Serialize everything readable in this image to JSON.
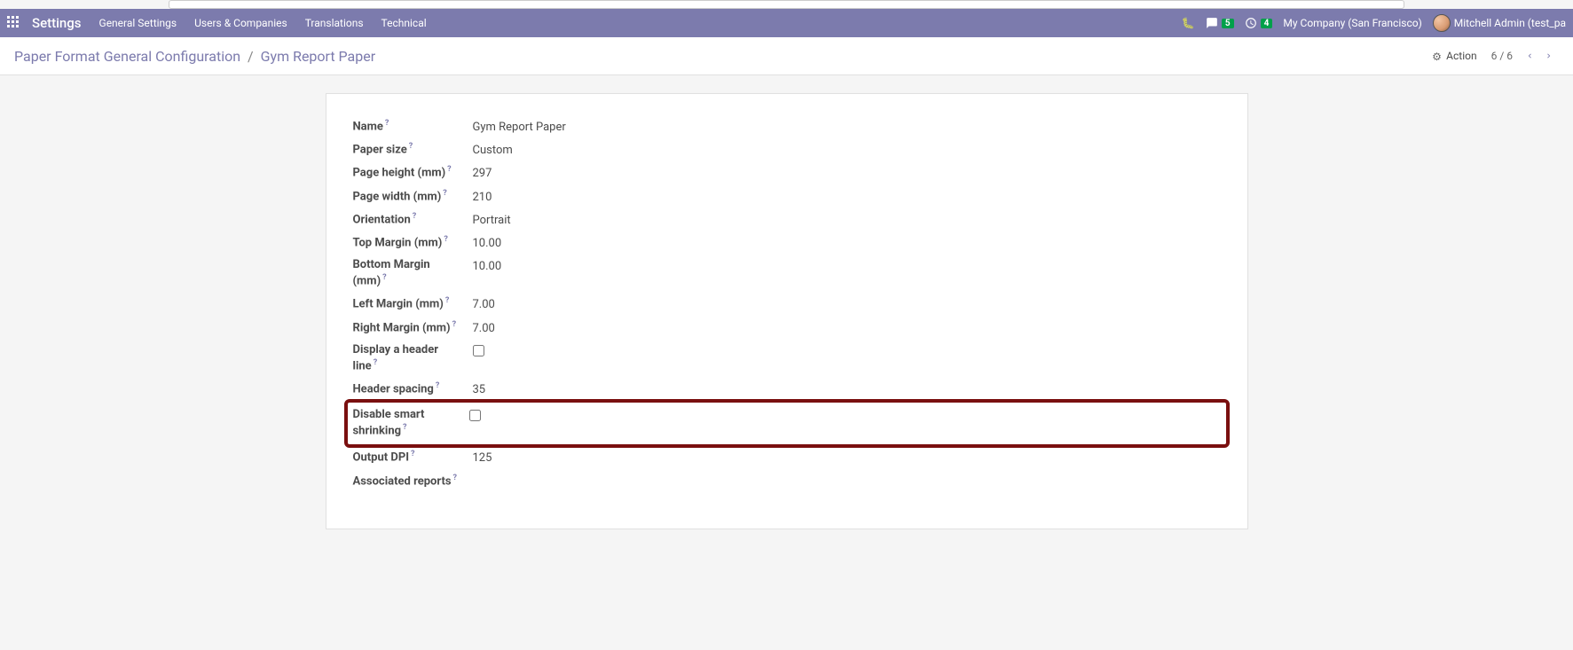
{
  "topnav": {
    "brand": "Settings",
    "menu": [
      "General Settings",
      "Users & Companies",
      "Translations",
      "Technical"
    ],
    "messages_badge": "5",
    "activities_badge": "4",
    "company": "My Company (San Francisco)",
    "user": "Mitchell Admin (test_pa"
  },
  "breadcrumb": {
    "parent": "Paper Format General Configuration",
    "current": "Gym Report Paper",
    "action_label": "Action",
    "pager": "6 / 6"
  },
  "form": {
    "rows": [
      {
        "label": "Name",
        "value": "Gym Report Paper",
        "type": "text"
      },
      {
        "label": "Paper size",
        "value": "Custom",
        "type": "text"
      },
      {
        "label": "Page height (mm)",
        "value": "297",
        "type": "text"
      },
      {
        "label": "Page width (mm)",
        "value": "210",
        "type": "text"
      },
      {
        "label": "Orientation",
        "value": "Portrait",
        "type": "text"
      },
      {
        "label": "Top Margin (mm)",
        "value": "10.00",
        "type": "text"
      },
      {
        "label": "Bottom Margin (mm)",
        "value": "10.00",
        "type": "text"
      },
      {
        "label": "Left Margin (mm)",
        "value": "7.00",
        "type": "text"
      },
      {
        "label": "Right Margin (mm)",
        "value": "7.00",
        "type": "text"
      },
      {
        "label": "Display a header line",
        "value": "",
        "type": "checkbox",
        "checked": false
      },
      {
        "label": "Header spacing",
        "value": "35",
        "type": "text"
      },
      {
        "label": "Disable smart shrinking",
        "value": "",
        "type": "checkbox",
        "checked": false,
        "highlight": true
      },
      {
        "label": "Output DPI",
        "value": "125",
        "type": "text"
      },
      {
        "label": "Associated reports",
        "value": "",
        "type": "text"
      }
    ]
  }
}
